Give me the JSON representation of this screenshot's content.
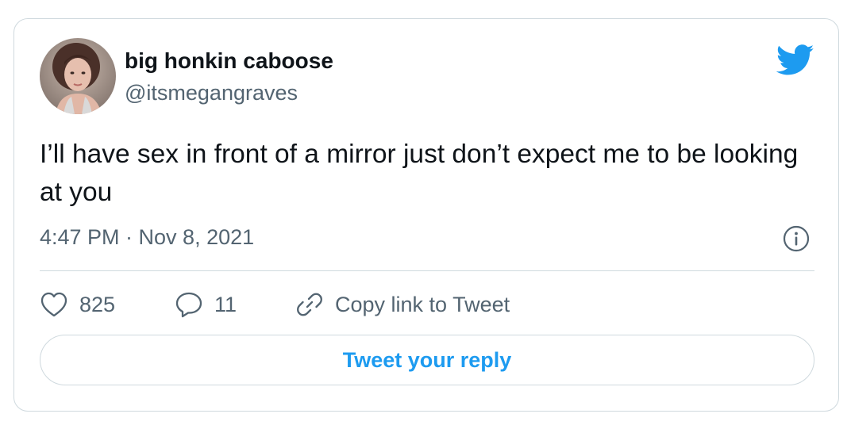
{
  "tweet": {
    "author": {
      "display_name": "big honkin caboose",
      "handle": "@itsmegangraves",
      "avatar": "avatar-photo"
    },
    "text": "I’ll have sex in front of a mirror just don’t expect me to be looking at you",
    "timestamp": "4:47 PM · Nov 8, 2021",
    "brand_icon": "twitter-bird-icon",
    "colors": {
      "brand": "#1d9bf0",
      "secondary_text": "#536471",
      "border": "#cfd9de"
    }
  },
  "actions": {
    "likes": {
      "icon": "heart-icon",
      "count": "825"
    },
    "replies": {
      "icon": "reply-bubble-icon",
      "count": "11"
    },
    "copy_link": {
      "icon": "link-icon",
      "label": "Copy link to Tweet"
    }
  },
  "reply": {
    "button_label": "Tweet your reply"
  }
}
